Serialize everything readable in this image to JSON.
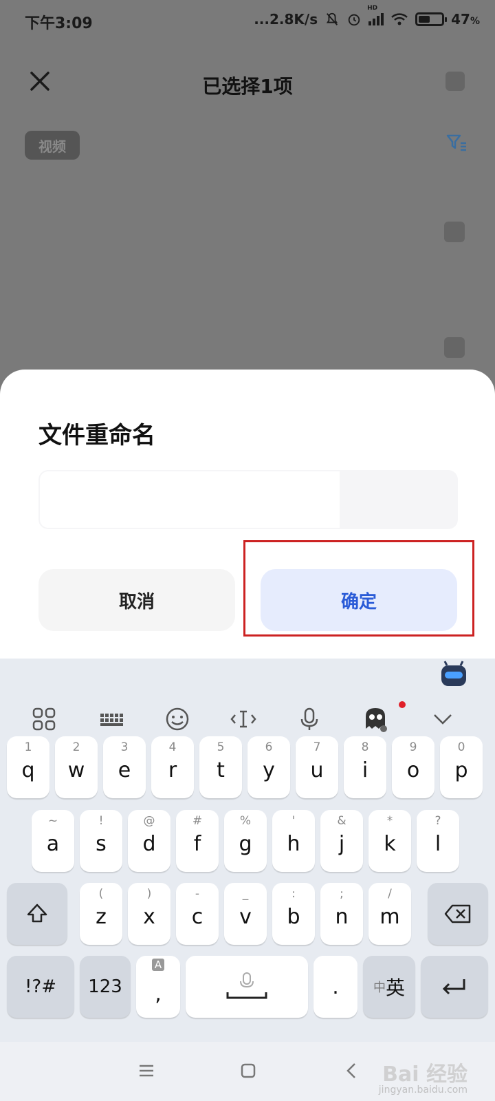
{
  "status": {
    "time": "下午3:09",
    "net_speed": "...2.8K/s",
    "hd_label": "HD",
    "battery": "47",
    "battery_level": 0.47
  },
  "page": {
    "title": "已选择1项",
    "chip": "视频"
  },
  "dialog": {
    "title": "文件重命名",
    "input_value": "",
    "cancel_label": "取消",
    "ok_label": "确定"
  },
  "keyboard": {
    "row1": [
      {
        "hint": "1",
        "key": "q"
      },
      {
        "hint": "2",
        "key": "w"
      },
      {
        "hint": "3",
        "key": "e"
      },
      {
        "hint": "4",
        "key": "r"
      },
      {
        "hint": "5",
        "key": "t"
      },
      {
        "hint": "6",
        "key": "y"
      },
      {
        "hint": "7",
        "key": "u"
      },
      {
        "hint": "8",
        "key": "i"
      },
      {
        "hint": "9",
        "key": "o"
      },
      {
        "hint": "0",
        "key": "p"
      }
    ],
    "row2": [
      {
        "hint": "~",
        "key": "a"
      },
      {
        "hint": "!",
        "key": "s"
      },
      {
        "hint": "@",
        "key": "d"
      },
      {
        "hint": "#",
        "key": "f"
      },
      {
        "hint": "%",
        "key": "g"
      },
      {
        "hint": "'",
        "key": "h"
      },
      {
        "hint": "&",
        "key": "j"
      },
      {
        "hint": "*",
        "key": "k"
      },
      {
        "hint": "?",
        "key": "l"
      }
    ],
    "row3": [
      {
        "hint": "(",
        "key": "z"
      },
      {
        "hint": ")",
        "key": "x"
      },
      {
        "hint": "-",
        "key": "c"
      },
      {
        "hint": "_",
        "key": "v"
      },
      {
        "hint": ":",
        "key": "b"
      },
      {
        "hint": ";",
        "key": "n"
      },
      {
        "hint": "/",
        "key": "m"
      }
    ],
    "symbols_label": "!?#",
    "numbers_label": "123",
    "comma_hint": "A",
    "comma_label": ",",
    "period_label": ".",
    "lang_cn": "中",
    "lang_en": "英"
  },
  "watermark": {
    "text": "Bai 经验",
    "sub": "jingyan.baidu.com"
  }
}
